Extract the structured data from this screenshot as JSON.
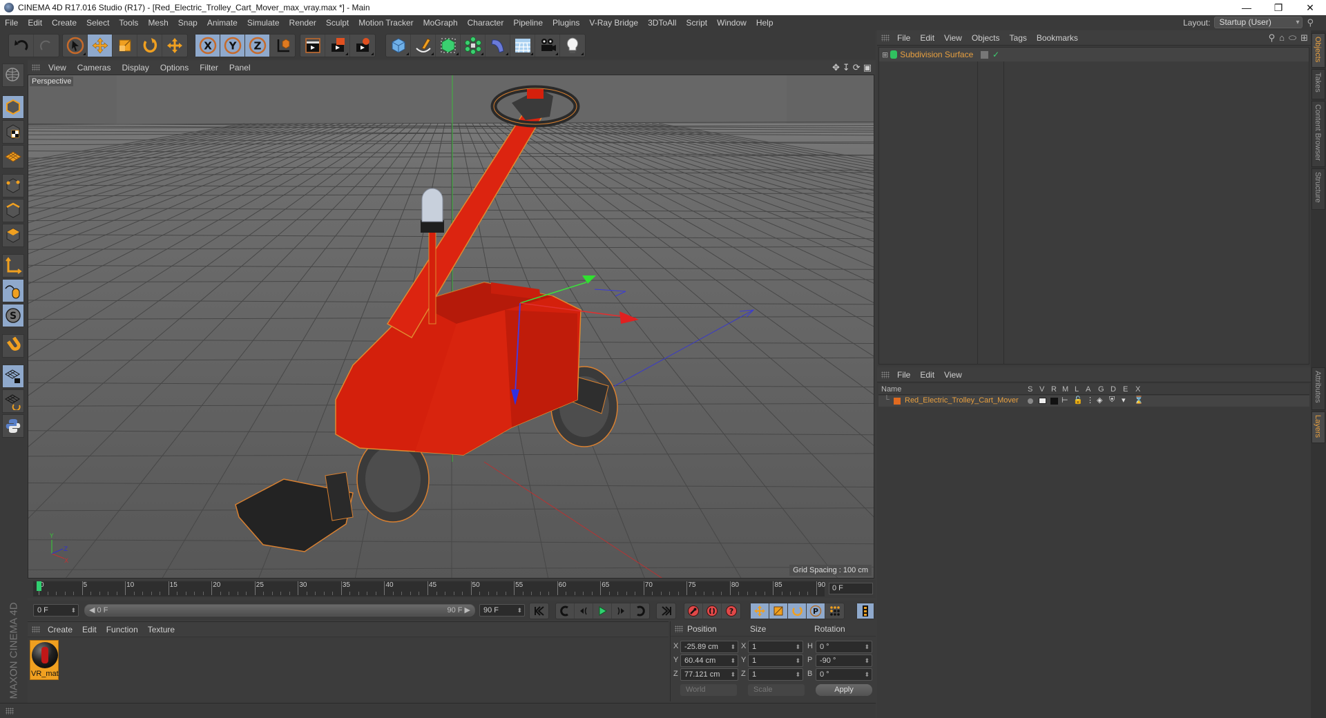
{
  "window": {
    "title": "CINEMA 4D R17.016 Studio (R17) - [Red_Electric_Trolley_Cart_Mover_max_vray.max *] - Main",
    "controls": [
      "minimize",
      "restore",
      "close"
    ]
  },
  "menubar": {
    "items": [
      "File",
      "Edit",
      "Create",
      "Select",
      "Tools",
      "Mesh",
      "Snap",
      "Animate",
      "Simulate",
      "Render",
      "Sculpt",
      "Motion Tracker",
      "MoGraph",
      "Character",
      "Pipeline",
      "Plugins",
      "V-Ray Bridge",
      "3DToAll",
      "Script",
      "Window",
      "Help"
    ],
    "layout_label": "Layout:",
    "layout_value": "Startup (User)"
  },
  "toolbar": {
    "groups": [
      {
        "name": "history",
        "icons": [
          "undo-icon",
          "redo-icon"
        ]
      },
      {
        "name": "tools",
        "icons": [
          "live-selection-icon",
          "move-icon",
          "scale-icon",
          "rotate-icon",
          "last-tool-icon"
        ]
      },
      {
        "name": "axes",
        "icons": [
          "x-axis-lock-icon",
          "y-axis-lock-icon",
          "z-axis-lock-icon",
          "coordinate-system-icon"
        ]
      },
      {
        "name": "render",
        "icons": [
          "render-view-icon",
          "render-picture-viewer-icon",
          "edit-render-settings-icon"
        ]
      },
      {
        "name": "create",
        "icons": [
          "cube-icon",
          "pen-spline-icon",
          "subdivision-icon",
          "array-icon",
          "deformer-icon",
          "floor-icon",
          "camera-icon",
          "light-icon"
        ]
      }
    ]
  },
  "left_toolbar": {
    "icons": [
      "make-editable-icon",
      "model-mode-icon",
      "texture-mode-icon",
      "workplane-mode-icon",
      "points-mode-icon",
      "edges-mode-icon",
      "polygons-mode-icon",
      "axis-mode-icon",
      "tweak-mode-icon",
      "solo-icon",
      "snap-icon",
      "workplane-lock-icon",
      "workplane-align-icon",
      "python-icon"
    ]
  },
  "viewport": {
    "menu": [
      "View",
      "Cameras",
      "Display",
      "Options",
      "Filter",
      "Panel"
    ],
    "camera_label": "Perspective",
    "grid_spacing": "Grid Spacing : 100 cm",
    "nav_icons": [
      "pan-icon",
      "dolly-icon",
      "orbit-icon",
      "maximize-view-icon"
    ],
    "axis_labels": {
      "x": "X",
      "y": "Y",
      "z": "Z"
    }
  },
  "timeline": {
    "ticks": [
      0,
      5,
      10,
      15,
      20,
      25,
      30,
      35,
      40,
      45,
      50,
      55,
      60,
      65,
      70,
      75,
      80,
      85,
      90
    ],
    "current_frame": "0 F",
    "start_field": "0 F",
    "range_start": "0 F",
    "range_end": "90 F",
    "end_field": "90 F"
  },
  "transport": {
    "buttons": [
      "go-to-start-icon",
      "previous-key-icon",
      "previous-frame-icon",
      "play-icon",
      "next-frame-icon",
      "next-key-icon",
      "go-to-end-icon",
      "record-icon",
      "autokey-icon",
      "keyframe-selection-icon",
      "key-move-icon",
      "key-scale-icon",
      "key-rotate-icon",
      "key-param-icon",
      "key-pla-icon",
      "timeline-icon"
    ]
  },
  "material_manager": {
    "menu": [
      "Create",
      "Edit",
      "Function",
      "Texture"
    ],
    "materials": [
      {
        "name": "VR_mat"
      }
    ],
    "logo": "MAXON CINEMA 4D"
  },
  "coordinates": {
    "headers": [
      "Position",
      "Size",
      "Rotation"
    ],
    "position": [
      {
        "axis": "X",
        "value": "-25.89 cm"
      },
      {
        "axis": "Y",
        "value": "60.44 cm"
      },
      {
        "axis": "Z",
        "value": "77.121 cm"
      }
    ],
    "size": [
      {
        "axis": "X",
        "value": "1"
      },
      {
        "axis": "Y",
        "value": "1"
      },
      {
        "axis": "Z",
        "value": "1"
      }
    ],
    "rotation": [
      {
        "axis": "H",
        "value": "0 °"
      },
      {
        "axis": "P",
        "value": "-90 °"
      },
      {
        "axis": "B",
        "value": "0 °"
      }
    ],
    "mode_select": "World",
    "size_select": "Scale",
    "apply": "Apply"
  },
  "object_manager": {
    "menu": [
      "File",
      "Edit",
      "View",
      "Objects",
      "Tags",
      "Bookmarks"
    ],
    "objects": [
      {
        "name": "Subdivision Surface",
        "color": "#e8a040"
      }
    ]
  },
  "layer_manager": {
    "menu": [
      "File",
      "Edit",
      "View"
    ],
    "columns": [
      "Name",
      "S",
      "V",
      "R",
      "M",
      "L",
      "A",
      "G",
      "D",
      "E",
      "X"
    ],
    "layers": [
      {
        "name": "Red_Electric_Trolley_Cart_Mover",
        "color": "#e06a20"
      }
    ]
  },
  "right_tabs": {
    "top": [
      {
        "label": "Objects",
        "active": true
      },
      {
        "label": "Takes",
        "active": false
      },
      {
        "label": "Content Browser",
        "active": false
      },
      {
        "label": "Structure",
        "active": false
      }
    ],
    "bottom": [
      {
        "label": "Attributes",
        "active": false
      },
      {
        "label": "Layers",
        "active": true
      }
    ]
  },
  "colors": {
    "accent": "#e8a040",
    "selected_button": "#8fa9cc",
    "panel": "#3a3a3a",
    "viewport": "#5c5c5c",
    "trolley_red": "#d92010"
  }
}
